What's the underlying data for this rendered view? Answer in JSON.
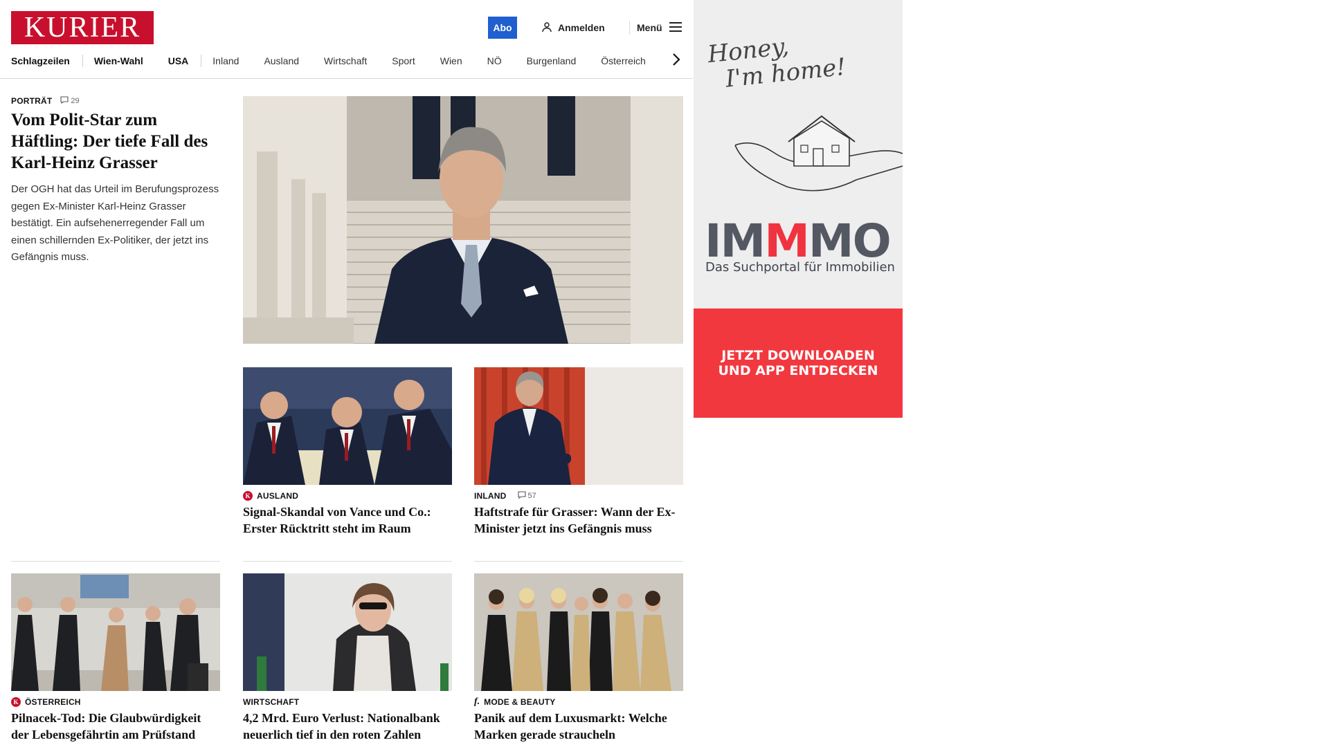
{
  "header": {
    "logo": "KURIER",
    "abo_label": "Abo",
    "login_label": "Anmelden",
    "menu_label": "Menü"
  },
  "nav": {
    "items": [
      "Schlagzeilen",
      "Wien-Wahl",
      "USA",
      "Inland",
      "Ausland",
      "Wirtschaft",
      "Sport",
      "Wien",
      "NÖ",
      "Burgenland",
      "Österreich"
    ]
  },
  "lead": {
    "kicker": "PORTRÄT",
    "comments": "29",
    "title": "Vom Polit-Star zum Häftling: Der tiefe Fall des Karl-Heinz Grasser",
    "text": "Der OGH hat das Urteil im Berufungsprozess gegen Ex-Minister Karl-Heinz Grasser bestätigt. Ein aufsehenerregender Fall um einen schillernden Ex-Politiker, der jetzt ins Gefängnis muss."
  },
  "cards": [
    {
      "kicker": "AUSLAND",
      "badge": "K",
      "comments": "",
      "title": "Signal-Skandal von Vance und Co.: Erster Rücktritt steht im Raum"
    },
    {
      "kicker": "INLAND",
      "badge": "",
      "comments": "57",
      "title": "Haftstrafe für Grasser: Wann der Ex-Minister jetzt ins Gefängnis muss"
    },
    {
      "kicker": "ÖSTERREICH",
      "badge": "K",
      "comments": "",
      "title": "Pilnacek-Tod: Die Glaubwürdigkeit der Lebensgefährtin am Prüfstand"
    },
    {
      "kicker": "WIRTSCHAFT",
      "badge": "",
      "comments": "",
      "title": "4,2 Mrd. Euro Verlust: Nationalbank neuerlich tief in den roten Zahlen"
    },
    {
      "kicker": "MODE & BEAUTY",
      "badge": "f.",
      "comments": "",
      "title": "Panik auf dem Luxusmarkt: Welche Marken gerade straucheln"
    }
  ],
  "ad": {
    "script_line1": "Honey,",
    "script_line2": "I'm home!",
    "brand_a": "IM",
    "brand_b": "M",
    "brand_c": "MO",
    "tagline": "Das Suchportal für Immobilien",
    "cta_line1": "JETZT DOWNLOADEN",
    "cta_line2": "UND APP ENTDECKEN"
  },
  "colors": {
    "brand_red": "#c8102e",
    "abo_blue": "#1f5fcf",
    "ad_red": "#f2383f",
    "ad_grey": "#545863"
  }
}
